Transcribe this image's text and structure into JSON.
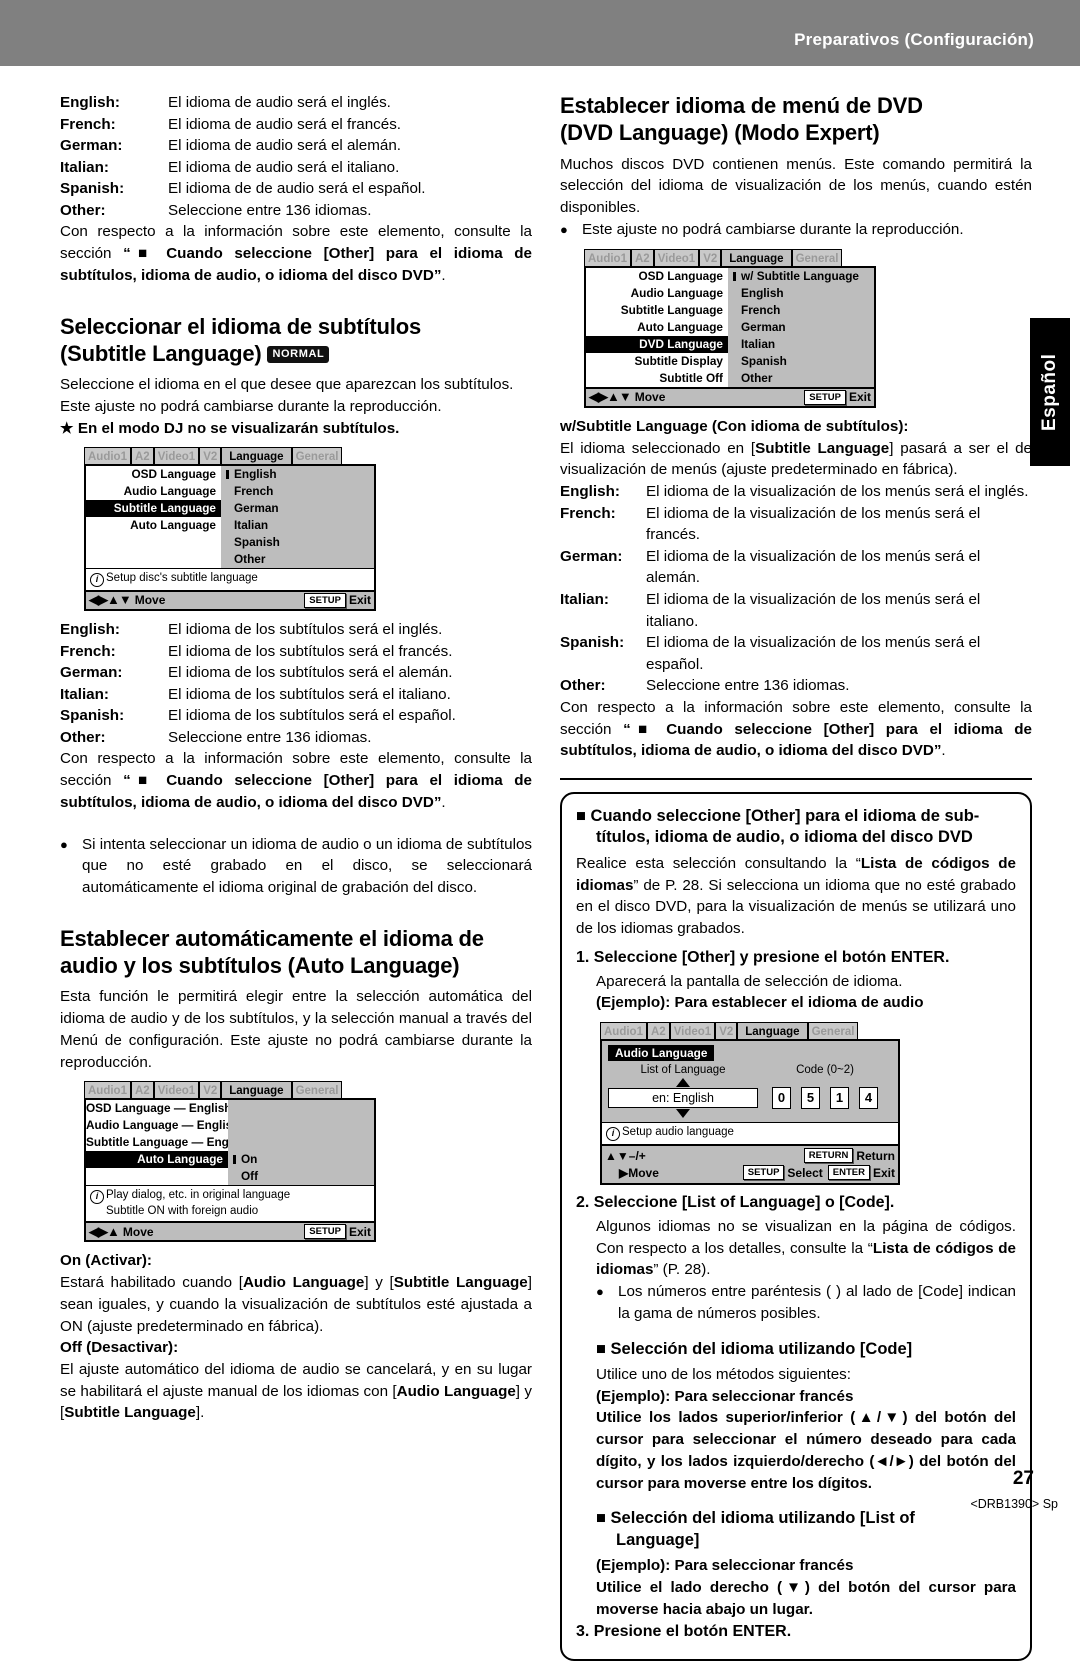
{
  "header": {
    "title": "Preparativos (Configuración)"
  },
  "side_tab": {
    "label": "Español"
  },
  "footer": {
    "page_number": "27",
    "code": "<DRB1390> Sp"
  },
  "left_column": {
    "audio_lang_defs": [
      {
        "term": "English:",
        "desc": "El idioma de audio será el inglés."
      },
      {
        "term": "French:",
        "desc": "El idioma de audio será el francés."
      },
      {
        "term": "German:",
        "desc": "El idioma de audio será el alemán."
      },
      {
        "term": "Italian:",
        "desc": "El idioma de audio será el italiano."
      },
      {
        "term": "Spanish:",
        "desc": "El idioma de de audio será el español."
      },
      {
        "term": "Other:",
        "desc": "Seleccione entre 136 idiomas."
      }
    ],
    "audio_ref_plain_1": "Con respecto a la información sobre este elemento, consulte la sección ",
    "audio_ref_bold": "“■ Cuando seleccione [Other] para el idioma de subtítulos, idioma de audio, o idioma del disco DVD”",
    "audio_ref_plain_2": ".",
    "subtitle_section": {
      "heading_line1": "Seleccionar el idioma de subtítulos",
      "heading_line2": "(Subtitle Language)",
      "badge": "NORMAL",
      "intro": "Seleccione el idioma en el que desee que aparezcan los subtítulos. Este ajuste no podrá cambiarse durante la reproducción.",
      "star_note": "★ En el modo DJ no se visualizarán subtítulos.",
      "osd": {
        "tabs": [
          "Audio1",
          "A2",
          "Video1",
          "V2",
          "Language",
          "General"
        ],
        "active_tab": "Language",
        "left_items": [
          "OSD Language",
          "Audio Language",
          "Subtitle Language",
          "Auto Language"
        ],
        "selected_left": "Subtitle Language",
        "right_items": [
          "English",
          "French",
          "German",
          "Italian",
          "Spanish",
          "Other"
        ],
        "cursor_right": "English",
        "info": "Setup disc's subtitle language",
        "foot_move": "Move",
        "foot_key": "SETUP",
        "foot_exit": "Exit"
      },
      "defs": [
        {
          "term": "English:",
          "desc": "El idioma de los subtítulos será el inglés."
        },
        {
          "term": "French:",
          "desc": "El idioma de los subtítulos será el francés."
        },
        {
          "term": "German:",
          "desc": "El idioma de los subtítulos será el alemán."
        },
        {
          "term": "Italian:",
          "desc": "El idioma de los subtítulos será el italiano."
        },
        {
          "term": "Spanish:",
          "desc": "El idioma de los subtítulos será el español."
        },
        {
          "term": "Other:",
          "desc": "Seleccione entre 136 idiomas."
        }
      ],
      "ref_plain_1": "Con respecto a la información sobre este elemento, consulte la sección ",
      "ref_bold": "“■ Cuando seleccione [Other] para el idioma de subtítulos, idioma de audio, o idioma del disco DVD”",
      "ref_plain_2": ".",
      "bullet": "Si intenta seleccionar un idioma de audio o un idioma de subtítulos que no esté grabado en el disco, se seleccionará automáticamente el idioma original de grabación del disco."
    },
    "auto_section": {
      "heading_line1": "Establecer automáticamente el idioma de",
      "heading_line2": "audio y los subtítulos (Auto Language)",
      "intro": "Esta función le permitirá elegir entre la selección automática del idioma de audio y de los subtítulos, y la selección manual a través del Menú de configuración. Este ajuste no podrá cambiarse durante la reproducción.",
      "osd": {
        "tabs": [
          "Audio1",
          "A2",
          "Video1",
          "V2",
          "Language",
          "General"
        ],
        "active_tab": "Language",
        "left_items": [
          "OSD Language — English",
          "Audio Language — English",
          "Subtitle Language — English",
          "Auto Language"
        ],
        "selected_left": "Auto Language",
        "right_items": [
          "On",
          "Off"
        ],
        "cursor_right": "On",
        "info_line1": "Play dialog, etc. in original language",
        "info_line2": "Subtitle ON with foreign audio",
        "foot_move": "Move",
        "foot_key": "SETUP",
        "foot_exit": "Exit"
      },
      "on_term": "On (Activar):",
      "on_desc_a": "Estará habilitado cuando [",
      "on_desc_b": "Audio Language",
      "on_desc_c": "] y [",
      "on_desc_d": "Subtitle Language",
      "on_desc_e": "] sean iguales, y cuando la visualización de subtítulos esté ajustada a ON (ajuste predeterminado en fábrica).",
      "off_term": "Off (Desactivar):",
      "off_desc_a": "El ajuste automático del idioma de audio se cancelará, y en su lugar se habilitará el ajuste manual de los idiomas con [",
      "off_desc_b": "Audio Language",
      "off_desc_c": "] y [",
      "off_desc_d": "Subtitle Language",
      "off_desc_e": "]."
    }
  },
  "right_column": {
    "dvd_section": {
      "heading_line1": "Establecer idioma de menú de DVD",
      "heading_line2": "(DVD Language) (Modo Expert)",
      "intro": "Muchos discos DVD contienen menús.  Este comando permitirá la selección del idioma de visualización de los menús, cuando estén disponibles.",
      "bullet": "Este ajuste no podrá cambiarse durante la reproducción.",
      "osd": {
        "tabs": [
          "Audio1",
          "A2",
          "Video1",
          "V2",
          "Language",
          "General"
        ],
        "active_tab": "Language",
        "left_items": [
          "OSD Language",
          "Audio Language",
          "Subtitle Language",
          "Auto Language",
          "DVD Language",
          "Subtitle Display",
          "Subtitle Off"
        ],
        "selected_left": "DVD Language",
        "right_items": [
          "w/ Subtitle Language",
          "English",
          "French",
          "German",
          "Italian",
          "Spanish",
          "Other"
        ],
        "cursor_right": "w/ Subtitle Language",
        "foot_move": "Move",
        "foot_key": "SETUP",
        "foot_exit": "Exit"
      },
      "wsub_term": "w/Subtitle Language (Con idioma de subtítulos):",
      "wsub_desc_a": "El idioma seleccionado en [",
      "wsub_desc_b": "Subtitle Language",
      "wsub_desc_c": "] pasará a ser el de visualización de menús (ajuste predeterminado en fábrica).",
      "defs": [
        {
          "term": "English:",
          "desc": "El idioma de la visualización de los menús será el inglés."
        },
        {
          "term": "French:",
          "desc": "El idioma de la visualización de los menús será el francés."
        },
        {
          "term": "German:",
          "desc": "El idioma de la visualización de los menús será el alemán."
        },
        {
          "term": "Italian:",
          "desc": "El idioma de la visualización de los menús será el italiano."
        },
        {
          "term": "Spanish:",
          "desc": "El idioma de la visualización de los menús será el español."
        },
        {
          "term": "Other:",
          "desc": "Seleccione entre 136 idiomas."
        }
      ],
      "ref_plain_1": "Con respecto a la información sobre este elemento, consulte la sección ",
      "ref_bold": "“■ Cuando seleccione [Other] para el idioma de subtítulos, idioma de audio, o idioma del disco DVD”",
      "ref_plain_2": "."
    },
    "other_box": {
      "heading_line1": "■ Cuando seleccione [Other] para el idioma de sub-",
      "heading_line2": "títulos, idioma de audio, o idioma del disco DVD",
      "para_a": "Realice esta selección consultando la “",
      "para_b": "Lista de códigos de idiomas",
      "para_c": "” de P. 28. Si selecciona un idioma que no esté grabado en el disco DVD, para la visualización de menús se utilizará uno de los idiomas grabados.",
      "step1": "1. Seleccione [Other] y presione el botón ENTER.",
      "step1_desc": "Aparecerá la pantalla de selección de idioma.",
      "step1_example": "(Ejemplo): Para establecer el idioma de audio",
      "osd": {
        "tabs": [
          "Audio1",
          "A2",
          "Video1",
          "V2",
          "Language",
          "General"
        ],
        "active_tab": "Language",
        "title": "Audio Language",
        "label_list": "List of Language",
        "label_code": "Code (0~2)",
        "list_value": "en: English",
        "digits": [
          "0",
          "5",
          "1",
          "4"
        ],
        "info": "Setup audio language",
        "foot_plusminus": "–/+",
        "foot_move": "Move",
        "key_return": "RETURN",
        "label_return": "Return",
        "key_setup": "SETUP",
        "label_select": "Select",
        "key_enter": "ENTER",
        "label_exit": "Exit"
      },
      "step2": "2. Seleccione [List of Language] o [Code].",
      "step2_desc_a": "Algunos idiomas no se visualizan en la página de códigos. Con respecto a los detalles, consulte la “",
      "step2_desc_b": "Lista de códigos de idiomas",
      "step2_desc_c": "” (P. 28).",
      "step2_bullet": "Los números entre paréntesis ( ) al lado de [Code] indican la gama de números posibles.",
      "code_head": "■ Selección del idioma utilizando [Code]",
      "code_intro": "Utilice uno de los métodos siguientes:",
      "code_example": "(Ejemplo): Para seleccionar francés",
      "code_instr": "Utilice los lados superior/inferior (▲/▼) del botón del cursor para seleccionar el número deseado para cada dígito, y los lados izquierdo/derecho (◄/►) del botón del cursor para moverse entre los dígitos.",
      "list_head_line1": "■ Selección del idioma utilizando [List of",
      "list_head_line2": "Language]",
      "list_example": "(Ejemplo): Para seleccionar francés",
      "list_instr": "Utilice el lado derecho (▼) del botón del cursor para moverse hacia abajo un lugar.",
      "step3": "3. Presione el botón ENTER."
    }
  }
}
